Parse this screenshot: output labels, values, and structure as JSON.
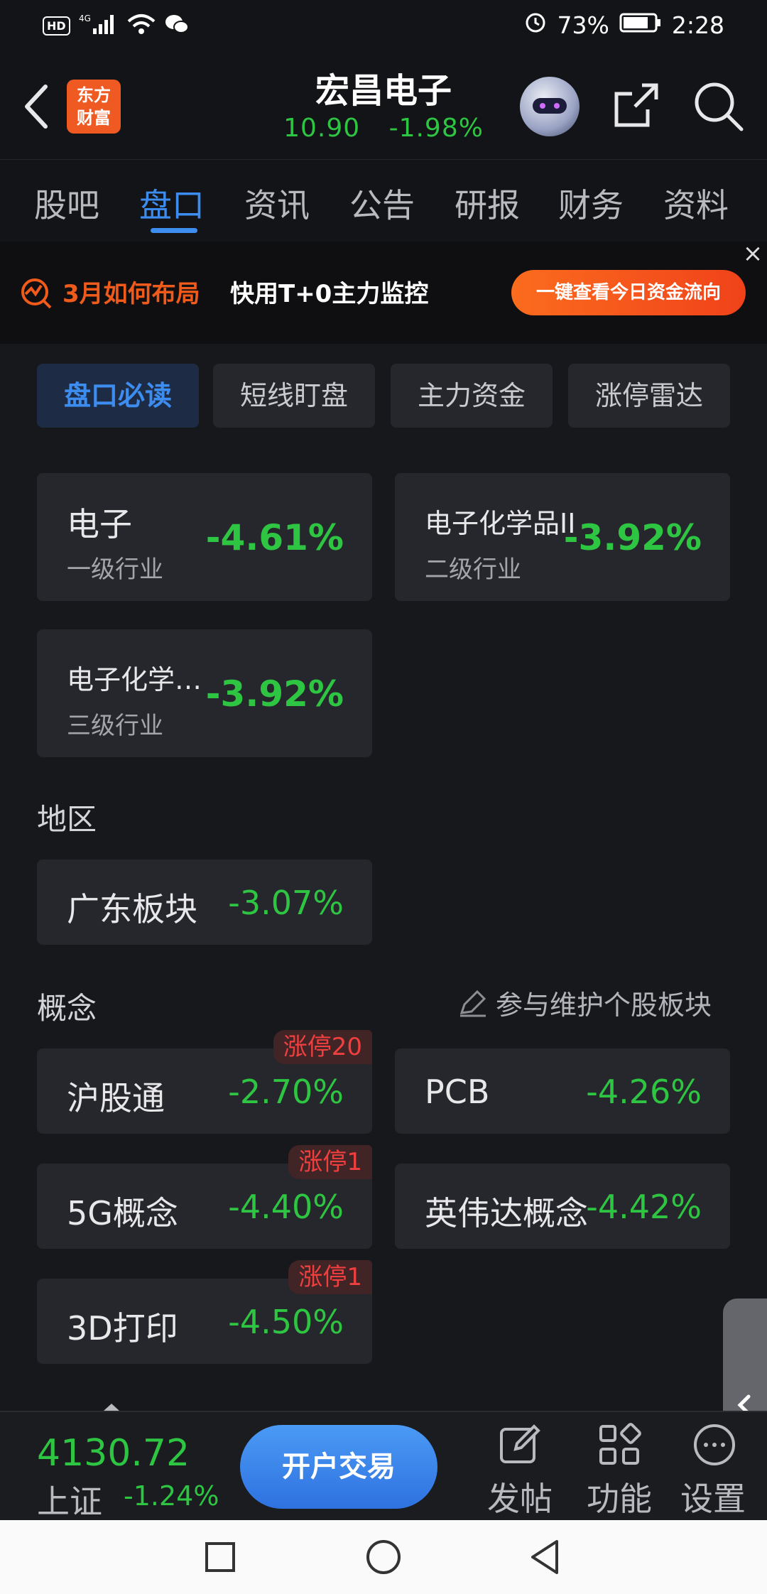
{
  "status_bar": {
    "hd": "HD",
    "net": "4G",
    "battery_pct": "73%",
    "time": "2:28",
    "icons": [
      "hd-icon",
      "signal-icon",
      "wifi-icon",
      "wechat-icon",
      "alarm-icon",
      "battery-icon"
    ]
  },
  "header": {
    "logo_line1": "东方",
    "logo_line2": "财富",
    "stock_name": "宏昌电子",
    "price": "10.90",
    "change_pct": "-1.98%",
    "icons": [
      "back-icon",
      "robot-assistant-icon",
      "share-icon",
      "search-icon"
    ]
  },
  "tabs": [
    {
      "label": "股吧"
    },
    {
      "label": "盘口"
    },
    {
      "label": "资讯"
    },
    {
      "label": "公告"
    },
    {
      "label": "研报"
    },
    {
      "label": "财务"
    },
    {
      "label": "资料"
    }
  ],
  "active_tab": "盘口",
  "banner": {
    "orange_text": "3月如何布局",
    "white_text": "快用T+0主力监控",
    "cta": "一键查看今日资金流向",
    "close": "×"
  },
  "subtabs": [
    {
      "label": "盘口必读"
    },
    {
      "label": "短线盯盘"
    },
    {
      "label": "主力资金"
    },
    {
      "label": "涨停雷达"
    }
  ],
  "industry": [
    {
      "name": "电子",
      "level": "一级行业",
      "pct": "-4.61%"
    },
    {
      "name": "电子化学品II",
      "level": "二级行业",
      "pct": "-3.92%"
    },
    {
      "name": "电子化学…",
      "level": "三级行业",
      "pct": "-3.92%"
    }
  ],
  "region": {
    "title": "地区",
    "items": [
      {
        "name": "广东板块",
        "pct": "-3.07%"
      }
    ]
  },
  "concept": {
    "title": "概念",
    "maintain_label": "参与维护个股板块",
    "items": [
      {
        "name": "沪股通",
        "pct": "-2.70%",
        "limit": "涨停20"
      },
      {
        "name": "PCB",
        "pct": "-4.26%",
        "limit": ""
      },
      {
        "name": "5G概念",
        "pct": "-4.40%",
        "limit": "涨停1"
      },
      {
        "name": "英伟达概念",
        "pct": "-4.42%",
        "limit": ""
      },
      {
        "name": "3D打印",
        "pct": "-4.50%",
        "limit": "涨停1"
      }
    ]
  },
  "bottom_bar": {
    "index_value": "4130.72",
    "index_name": "上证",
    "index_change": "-1.24%",
    "trade_button": "开户交易",
    "actions": [
      {
        "label": "发帖",
        "icon": "edit-icon"
      },
      {
        "label": "功能",
        "icon": "grid-icon"
      },
      {
        "label": "设置",
        "icon": "more-icon"
      }
    ]
  },
  "colors": {
    "background": "#17181c",
    "accent_blue": "#3d8cf0",
    "down_green": "#2ec542",
    "limit_red": "#ef3f3f",
    "banner_orange": "#f05a1a"
  }
}
